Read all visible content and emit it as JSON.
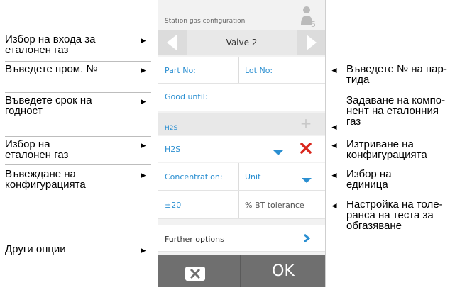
{
  "left_labels": [
    {
      "line1": "Избор на входа за",
      "line2": "еталонен газ"
    },
    {
      "line1": "Въведете пром. №",
      "line2": ""
    },
    {
      "line1": "Въведете срок на",
      "line2": "годност"
    },
    {
      "line1": "Избор на",
      "line2": "еталонен газ"
    },
    {
      "line1": "Въвеждане на",
      "line2": "конфигурацията"
    },
    {
      "line1": "Други опции",
      "line2": ""
    }
  ],
  "right_labels": [
    {
      "line1": "Въведете № на пар-",
      "line2": "тида",
      "line3": ""
    },
    {
      "line1": "Задаване на компо-",
      "line2": "нент на еталонния",
      "line3": "газ"
    },
    {
      "line1": "Изтриване на",
      "line2": "конфигурацията",
      "line3": ""
    },
    {
      "line1": "Избор на",
      "line2": "единица",
      "line3": ""
    },
    {
      "line1": "Настройка на толе-",
      "line2": "ранса на теста за",
      "line3": "обгазяване"
    }
  ],
  "arrows": {
    "right": "►",
    "left": "◄"
  },
  "screen": {
    "title": "Station gas configuration",
    "user_badge": "5",
    "valve": "Valve 2",
    "part_no": "Part No:",
    "lot_no": "Lot No:",
    "good_until": "Good until:",
    "gas_header": "H2S",
    "gas_select": "H2S",
    "concentration": "Concentration:",
    "unit": "Unit",
    "tolerance_value": "±20",
    "tolerance_label": "% BT tolerance",
    "further_options": "Further options",
    "ok": "OK"
  },
  "colors": {
    "accent": "#2b8fd1",
    "delete": "#d9261c",
    "footer": "#6f6f6f"
  }
}
